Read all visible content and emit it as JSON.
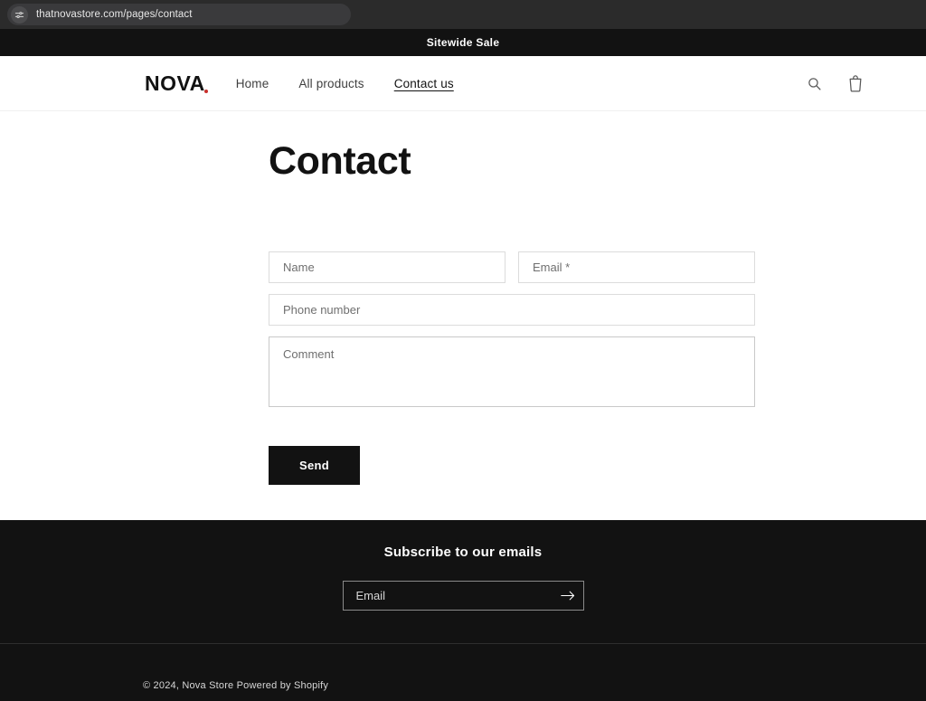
{
  "browser": {
    "url": "thatnovastore.com/pages/contact",
    "tune_icon": "sliders-icon"
  },
  "announcement": {
    "text": "Sitewide Sale"
  },
  "header": {
    "logo": "NOVA",
    "nav": [
      {
        "label": "Home",
        "active": false
      },
      {
        "label": "All products",
        "active": false
      },
      {
        "label": "Contact us",
        "active": true
      }
    ],
    "actions": [
      {
        "name": "search-icon",
        "label": "Search"
      },
      {
        "name": "cart-icon",
        "label": "Cart"
      }
    ]
  },
  "main": {
    "title": "Contact",
    "form": {
      "name_placeholder": "Name",
      "email_placeholder": "Email *",
      "phone_placeholder": "Phone number",
      "comment_placeholder": "Comment",
      "name_value": "",
      "email_value": "",
      "phone_value": "",
      "comment_value": "",
      "submit_label": "Send"
    }
  },
  "footer": {
    "newsletter_title": "Subscribe to our emails",
    "newsletter_placeholder": "Email",
    "newsletter_value": "",
    "newsletter_submit_icon": "arrow-right-icon",
    "copyright": "© 2024, Nova Store Powered by Shopify"
  },
  "colors": {
    "dark": "#121212",
    "accent_red": "#c9302c",
    "border": "#dcdcdc",
    "chrome": "#2b2b2b"
  }
}
